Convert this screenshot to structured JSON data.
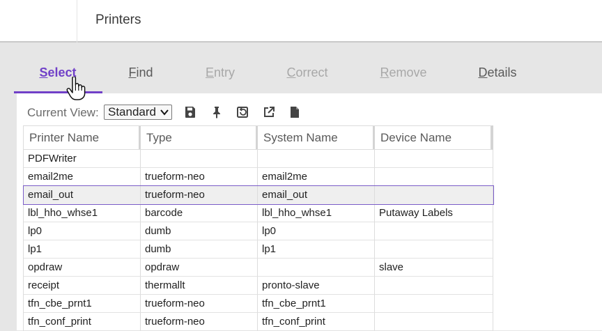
{
  "header": {
    "title": "Printers"
  },
  "tabs": [
    {
      "label": "Select",
      "accel": "S",
      "rest": "elect",
      "state": "active"
    },
    {
      "label": "Find",
      "accel": "F",
      "rest": "ind",
      "state": "enabled"
    },
    {
      "label": "Entry",
      "accel": "E",
      "rest": "ntry",
      "state": "disabled"
    },
    {
      "label": "Correct",
      "accel": "C",
      "rest": "orrect",
      "state": "disabled"
    },
    {
      "label": "Remove",
      "accel": "R",
      "rest": "emove",
      "state": "disabled"
    },
    {
      "label": "Details",
      "accel": "D",
      "rest": "etails",
      "state": "enabled"
    }
  ],
  "toolbar": {
    "current_view_label": "Current View:",
    "view_value": "Standard",
    "icons": [
      "save-icon",
      "pin-icon",
      "restore-icon",
      "external-link-icon",
      "document-icon"
    ]
  },
  "grid": {
    "columns": [
      "Printer Name",
      "Type",
      "System Name",
      "Device Name"
    ],
    "selected_row": 2,
    "rows": [
      [
        "PDFWriter",
        "",
        "",
        ""
      ],
      [
        "email2me",
        "trueform-neo",
        "email2me",
        ""
      ],
      [
        "email_out",
        "trueform-neo",
        "email_out",
        ""
      ],
      [
        "lbl_hho_whse1",
        "barcode",
        "lbl_hho_whse1",
        "Putaway Labels"
      ],
      [
        "lp0",
        "dumb",
        "lp0",
        ""
      ],
      [
        "lp1",
        "dumb",
        "lp1",
        ""
      ],
      [
        "opdraw",
        "opdraw",
        "",
        "slave"
      ],
      [
        "receipt",
        "thermallt",
        "pronto-slave",
        ""
      ],
      [
        "tfn_cbe_prnt1",
        "trueform-neo",
        "tfn_cbe_prnt1",
        ""
      ],
      [
        "tfn_conf_print",
        "trueform-neo",
        "tfn_conf_print",
        ""
      ]
    ]
  },
  "colors": {
    "accent": "#7040c8",
    "disabled": "#a8a8a8",
    "icon": "#444444"
  }
}
